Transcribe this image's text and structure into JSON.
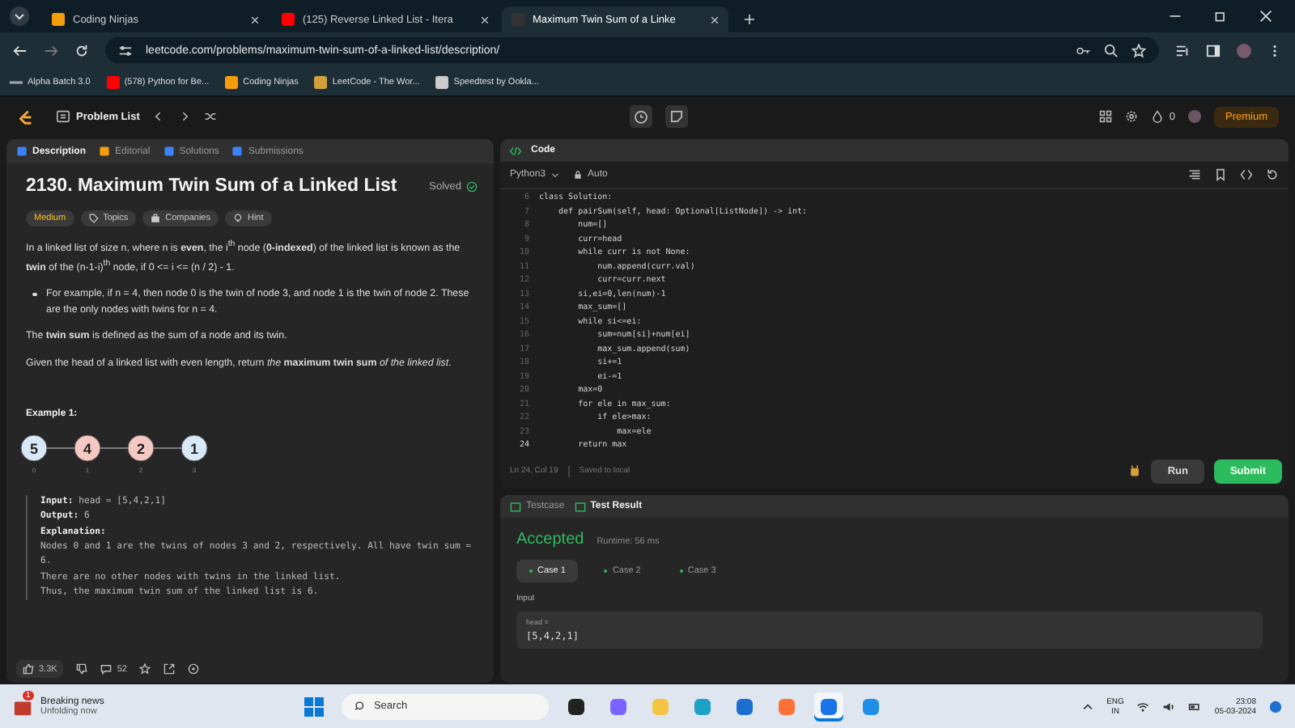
{
  "browser": {
    "tabs": [
      {
        "title": "Coding Ninjas",
        "selected": false
      },
      {
        "title": "(125) Reverse Linked List - Itera",
        "selected": false
      },
      {
        "title": "Maximum Twin Sum of a Linke",
        "selected": true
      }
    ],
    "url": "leetcode.com/problems/maximum-twin-sum-of-a-linked-list/description/",
    "bookmarks": [
      "Alpha Batch 3.0",
      "(578) Python for Be...",
      "Coding Ninjas",
      "LeetCode - The Wor...",
      "Speedtest by Ookla..."
    ]
  },
  "header": {
    "problem_list": "Problem List",
    "streak": "0",
    "premium": "Premium"
  },
  "problem": {
    "tabs": [
      {
        "label": "Description",
        "selected": true
      },
      {
        "label": "Editorial",
        "selected": false
      },
      {
        "label": "Solutions",
        "selected": false
      },
      {
        "label": "Submissions",
        "selected": false
      }
    ],
    "title": "2130. Maximum Twin Sum of a Linked List",
    "status": "Solved",
    "tags": [
      {
        "label": "Medium",
        "kind": "difficulty"
      },
      {
        "label": "Topics",
        "kind": "topics"
      },
      {
        "label": "Companies",
        "kind": "companies"
      },
      {
        "label": "Hint",
        "kind": "hint"
      }
    ],
    "body": [
      {
        "kind": "para",
        "text": "In a linked list of size n, where n is **even**, the i$^{th}$ node (**0-indexed**) of the linked list is known as the **twin** of the (n-1-i)$^{th}$ node, if 0 <= i <= (n / 2) - 1."
      },
      {
        "kind": "bullet",
        "text": "For example, if n = 4, then node 0 is the twin of node 3, and node 1 is the twin of node 2. These are the only nodes with twins for n = 4."
      },
      {
        "kind": "para",
        "text": "The **twin sum** is defined as the sum of a node and its twin."
      },
      {
        "kind": "para",
        "text": "Given the head of a linked list with even length, return *the* **maximum twin sum** *of the linked list*."
      }
    ],
    "example_title": "Example 1:",
    "nodes": [
      {
        "value": "5",
        "index": "0",
        "color": "#d9e8f8"
      },
      {
        "value": "4",
        "index": "1",
        "color": "#f5c8c4"
      },
      {
        "value": "2",
        "index": "2",
        "color": "#f5c8c4"
      },
      {
        "value": "1",
        "index": "3",
        "color": "#d9e8f8"
      }
    ],
    "example": [
      "**Input:** head = [5,4,2,1]",
      "**Output:** 6",
      "**Explanation:**",
      "Nodes 0 and 1 are the twins of nodes 3 and 2, respectively. All have twin sum = 6.",
      "There are no other nodes with twins in the linked list.",
      "Thus, the maximum twin sum of the linked list is 6."
    ],
    "likes": "3.3K",
    "comments": "52"
  },
  "editor": {
    "title": "Code",
    "language": "Python3",
    "mode": "Auto",
    "lines": [
      {
        "n": "6",
        "text": "class Solution:",
        "active": false
      },
      {
        "n": "7",
        "text": "    def pairSum(self, head: Optional[ListNode]) -> int:",
        "active": false
      },
      {
        "n": "8",
        "text": "        num=[]",
        "active": false
      },
      {
        "n": "9",
        "text": "        curr=head",
        "active": false
      },
      {
        "n": "10",
        "text": "        while curr is not None:",
        "active": false
      },
      {
        "n": "11",
        "text": "            num.append(curr.val)",
        "active": false
      },
      {
        "n": "12",
        "text": "            curr=curr.next",
        "active": false
      },
      {
        "n": "13",
        "text": "        si,ei=0,len(num)-1",
        "active": false
      },
      {
        "n": "14",
        "text": "        max_sum=[]",
        "active": false
      },
      {
        "n": "15",
        "text": "        while si<=ei:",
        "active": false
      },
      {
        "n": "16",
        "text": "            sum=num[si]+num[ei]",
        "active": false
      },
      {
        "n": "17",
        "text": "            max_sum.append(sum)",
        "active": false
      },
      {
        "n": "18",
        "text": "            si+=1",
        "active": false
      },
      {
        "n": "19",
        "text": "            ei-=1",
        "active": false
      },
      {
        "n": "20",
        "text": "        max=0",
        "active": false
      },
      {
        "n": "21",
        "text": "        for ele in max_sum:",
        "active": false
      },
      {
        "n": "22",
        "text": "            if ele>max:",
        "active": false
      },
      {
        "n": "23",
        "text": "                max=ele",
        "active": false
      },
      {
        "n": "24",
        "text": "        return max",
        "active": true
      }
    ],
    "position": "Ln 24, Col 19",
    "saved": "Saved to local",
    "run": "Run",
    "submit": "Submit"
  },
  "result": {
    "tabs": [
      {
        "label": "Testcase",
        "selected": false
      },
      {
        "label": "Test Result",
        "selected": true
      }
    ],
    "verdict": "Accepted",
    "runtime": "Runtime: 56 ms",
    "cases": [
      {
        "label": "Case 1",
        "selected": true
      },
      {
        "label": "Case 2",
        "selected": false
      },
      {
        "label": "Case 3",
        "selected": false
      }
    ],
    "input_label": "Input",
    "param": "head =",
    "value": "[5,4,2,1]"
  },
  "taskbar": {
    "news_badge": "1",
    "news_title": "Breaking news",
    "news_subtitle": "Unfolding now",
    "search_placeholder": "Search",
    "apps": [
      {
        "selected": false
      },
      {
        "selected": false
      },
      {
        "selected": false
      },
      {
        "selected": false
      },
      {
        "selected": false
      },
      {
        "selected": false
      },
      {
        "selected": true
      },
      {
        "selected": false
      }
    ],
    "lang": "ENG",
    "region": "IN",
    "time": "23:08",
    "date": "05-03-2024"
  }
}
